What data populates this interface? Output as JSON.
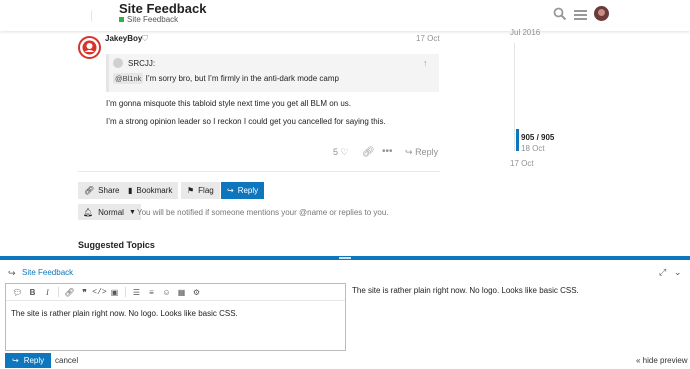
{
  "header": {
    "site_title": "Site Feedback",
    "category": "Site Feedback",
    "category_color": "#2fb344"
  },
  "post": {
    "username": "JakeyBoy",
    "date": "17 Oct",
    "quote": {
      "user": "SRCJJ:",
      "mention": "@Bl1nk",
      "text": " I’m sorry bro, but I’m firmly in the anti-dark mode camp"
    },
    "body": [
      "I’m gonna misquote this tabloid style next time you get all BLM on us.",
      "I’m a strong opinion leader so I reckon I could get you cancelled for saying this."
    ],
    "likes": "5",
    "reply_label": "Reply"
  },
  "timeline": {
    "top_date": "Jul 2016",
    "count": "905 / 905",
    "sub_date": "18 Oct",
    "bottom_date": "17 Oct",
    "accent": "#0e76bd"
  },
  "footer_buttons": {
    "share": "Share",
    "bookmark": "Bookmark",
    "flag": "Flag",
    "reply": "Reply"
  },
  "notifications": {
    "level": "Normal",
    "text": "You will be notified if someone mentions your @name or replies to you."
  },
  "suggested_heading": "Suggested Topics",
  "composer": {
    "title": "Site Feedback",
    "editor_text": "The site is rather plain right now. No logo. Looks like basic CSS.",
    "preview_text": "The site is rather plain right now. No logo. Looks like basic CSS.",
    "reply_button": "Reply",
    "cancel": "cancel",
    "hide_preview": "« hide preview"
  },
  "icons": [
    "search-icon",
    "hamburger-icon",
    "user-avatar",
    "shield-icon",
    "up-arrow-icon",
    "heart-icon",
    "link-icon",
    "more-icon",
    "reply-icon",
    "share-icon",
    "bookmark-icon",
    "flag-icon",
    "notification-icon",
    "chevron-down-icon",
    "expand-icon",
    "collapse-icon"
  ]
}
